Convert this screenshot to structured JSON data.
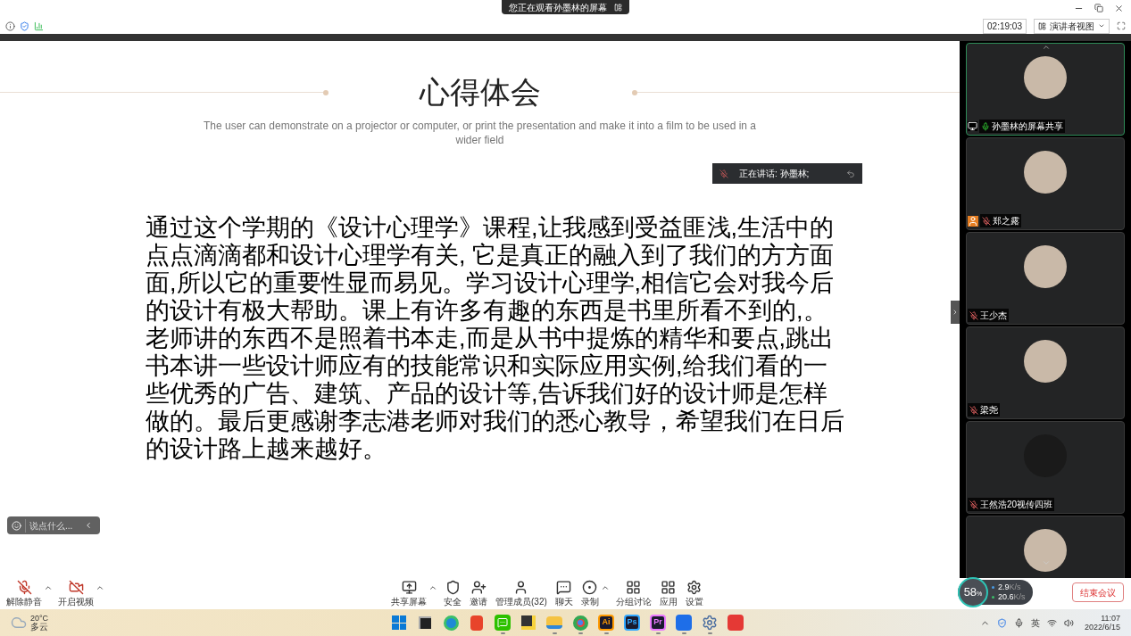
{
  "banner": {
    "text": "您正在观看孙墨林的屏幕"
  },
  "top_bar": {
    "timer": "02:19:03",
    "view_button": "演讲者视图"
  },
  "slide": {
    "title": "心得体会",
    "subtitle": "The user can demonstrate on a projector or computer, or print the presentation and make it into a film to be used in a wider field",
    "speaking": "正在讲话: 孙墨林;",
    "body": "通过这个学期的《设计心理学》课程,让我感到受益匪浅,生活中的点点滴滴都和设计心理学有关, 它是真正的融入到了我们的方方面面,所以它的重要性显而易见。学习设计心理学,相信它会对我今后的设计有极大帮助。课上有许多有趣的东西是书里所看不到的,。老师讲的东西不是照着书本走,而是从书中提炼的精华和要点,跳出书本讲一些设计师应有的技能常识和实际应用实例,给我们看的一些优秀的广告、建筑、产品的设计等,告诉我们好的设计师是怎样做的。最后更感谢李志港老师对我们的悉心教导，希望我们在日后的设计路上越来越好。"
  },
  "chat_input": {
    "placeholder": "说点什么..."
  },
  "participants": [
    {
      "name": "孙墨林的屏幕共享",
      "kind": "sharer",
      "selected": true,
      "muted": false,
      "photo": true
    },
    {
      "name": "郑之露",
      "kind": "host",
      "selected": false,
      "muted": true,
      "photo": true
    },
    {
      "name": "王少杰",
      "kind": "member",
      "selected": false,
      "muted": true,
      "photo": true
    },
    {
      "name": "梁尧",
      "kind": "member",
      "selected": false,
      "muted": true,
      "photo": true
    },
    {
      "name": "王然浩20视传四班",
      "kind": "member",
      "selected": false,
      "muted": true,
      "photo": false
    },
    {
      "kind": "member",
      "selected": false,
      "photo": true
    }
  ],
  "toolbar_left": [
    {
      "label": "解除静音",
      "kind": "mic-off",
      "menu": true
    },
    {
      "label": "开启视频",
      "kind": "video-off",
      "menu": true
    }
  ],
  "toolbar_center": [
    {
      "label": "共享屏幕",
      "kind": "share",
      "menu": true
    },
    {
      "label": "安全",
      "kind": "shield",
      "menu": false
    },
    {
      "label": "邀请",
      "kind": "invite",
      "menu": false
    },
    {
      "label": "管理成员(32)",
      "kind": "members",
      "menu": false
    },
    {
      "label": "聊天",
      "kind": "chat",
      "menu": false
    },
    {
      "label": "录制",
      "kind": "record",
      "menu": true
    },
    {
      "label": "分组讨论",
      "kind": "groups",
      "menu": false
    },
    {
      "label": "应用",
      "kind": "apps",
      "menu": false
    },
    {
      "label": "设置",
      "kind": "settings",
      "menu": false
    }
  ],
  "network": {
    "percent": "58",
    "unit": "%",
    "upload": "2.9",
    "upload_unit": "K/s",
    "download": "20.6",
    "download_unit": "K/s"
  },
  "end_button": "结束会议",
  "taskbar": {
    "temperature": "20°C",
    "condition": "多云",
    "apps": [
      {
        "kind": "start",
        "running": false
      },
      {
        "kind": "tasks",
        "running": false
      },
      {
        "kind": "edge",
        "running": false
      },
      {
        "kind": "office",
        "running": false
      },
      {
        "kind": "wechat",
        "running": true
      },
      {
        "kind": "notes",
        "running": false
      },
      {
        "kind": "folder",
        "running": true
      },
      {
        "kind": "chrome",
        "running": true
      },
      {
        "kind": "letters",
        "letters": "Ai",
        "color": "#ff9a00",
        "running": true
      },
      {
        "kind": "letters",
        "letters": "Ps",
        "color": "#31a8ff",
        "running": false
      },
      {
        "kind": "letters",
        "letters": "Pr",
        "color": "#ea77ff",
        "running": true
      },
      {
        "kind": "meeting",
        "running": true
      },
      {
        "kind": "gear",
        "running": true
      },
      {
        "kind": "wps",
        "running": false
      }
    ],
    "ime": "英",
    "time": "11:07",
    "date": "2022/6/15"
  }
}
